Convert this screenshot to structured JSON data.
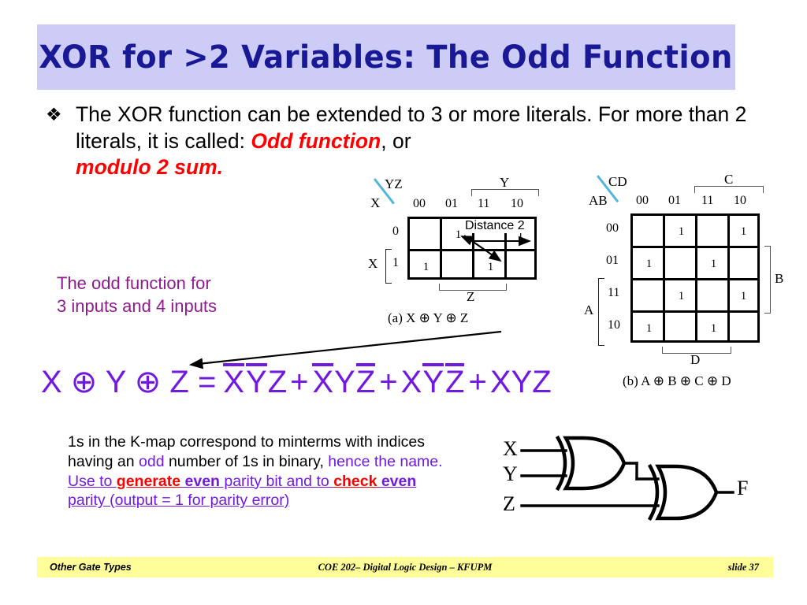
{
  "title": "XOR for >2 Variables: The Odd Function",
  "bullet": {
    "mark": "❖",
    "part1": "The XOR function can be extended to 3 or more literals. For more than  2 literals, it is called: ",
    "emphasis1": "Odd function",
    "part2": ", or ",
    "emphasis2": "modulo 2 sum."
  },
  "purple_note": {
    "line1": "The odd function for",
    "line2": "3 inputs and 4 inputs"
  },
  "equation": {
    "lhs": "X ⊕ Y ⊕ Z =",
    "terms": [
      {
        "x": "X",
        "x_bar": true,
        "y": "Y",
        "y_bar": true,
        "z": "Z",
        "z_bar": false
      },
      {
        "x": "X",
        "x_bar": true,
        "y": "Y",
        "y_bar": false,
        "z": "Z",
        "z_bar": true
      },
      {
        "x": "X",
        "x_bar": false,
        "y": "Y",
        "y_bar": true,
        "z": "Z",
        "z_bar": true
      },
      {
        "x": "X",
        "x_bar": false,
        "y": "Y",
        "y_bar": false,
        "z": "Z",
        "z_bar": false
      }
    ],
    "plus": "+"
  },
  "kmap3": {
    "corner_top_label": "YZ",
    "corner_bottom_label": "X",
    "col_headers": [
      "00",
      "01",
      "11",
      "10"
    ],
    "row_headers": [
      "0",
      "1"
    ],
    "top_group_label": "Y",
    "bottom_group_label": "Z",
    "left_group_label": "X",
    "cells": [
      [
        "",
        "1",
        "",
        "1"
      ],
      [
        "1",
        "",
        "1",
        ""
      ]
    ],
    "annotation": "Distance 2",
    "caption": "(a) X ⊕ Y ⊕ Z"
  },
  "kmap4": {
    "corner_top_label": "CD",
    "corner_bottom_label": "AB",
    "col_headers": [
      "00",
      "01",
      "11",
      "10"
    ],
    "row_headers": [
      "00",
      "01",
      "11",
      "10"
    ],
    "top_group_label": "C",
    "bottom_group_label": "D",
    "left_group_label": "A",
    "right_group_label": "B",
    "cells": [
      [
        "",
        "1",
        "",
        "1"
      ],
      [
        "1",
        "",
        "1",
        ""
      ],
      [
        "",
        "1",
        "",
        "1"
      ],
      [
        "1",
        "",
        "1",
        ""
      ]
    ],
    "caption": "(b) A ⊕ B ⊕ C ⊕ D"
  },
  "bottom_note": {
    "seg1": "1s in the K-map correspond to minterms with indices having an ",
    "seg2_purple": "odd",
    "seg3": " number of 1s in binary, ",
    "seg4_purple": "hence the name. ",
    "seg5_purple_ul": "Use to ",
    "seg6_red_ul": "generate",
    "seg7_purple_ul": " ",
    "seg8_purple_bold_ul": "even",
    "seg9_purple_ul": " parity bit and to ",
    "seg10_red_ul": "check",
    "seg11_purple_bold_ul": " even",
    "seg12_purple_ul": " parity (output = 1 for parity error)"
  },
  "circuit": {
    "input_x": "X",
    "input_y": "Y",
    "input_z": "Z",
    "output_f": "F"
  },
  "footer": {
    "left": "Other Gate Types",
    "center": "COE 202– Digital Logic  Design – KFUPM",
    "right": "slide 37"
  },
  "colors": {
    "title_bg": "#ccccf7",
    "title_text": "#191996",
    "accent_red": "#ff0000",
    "accent_purple": "#7219e0",
    "note_purple": "#8e1a8e",
    "footer_bg": "#ffff99",
    "diagonal_blue": "#4fb6dd"
  }
}
